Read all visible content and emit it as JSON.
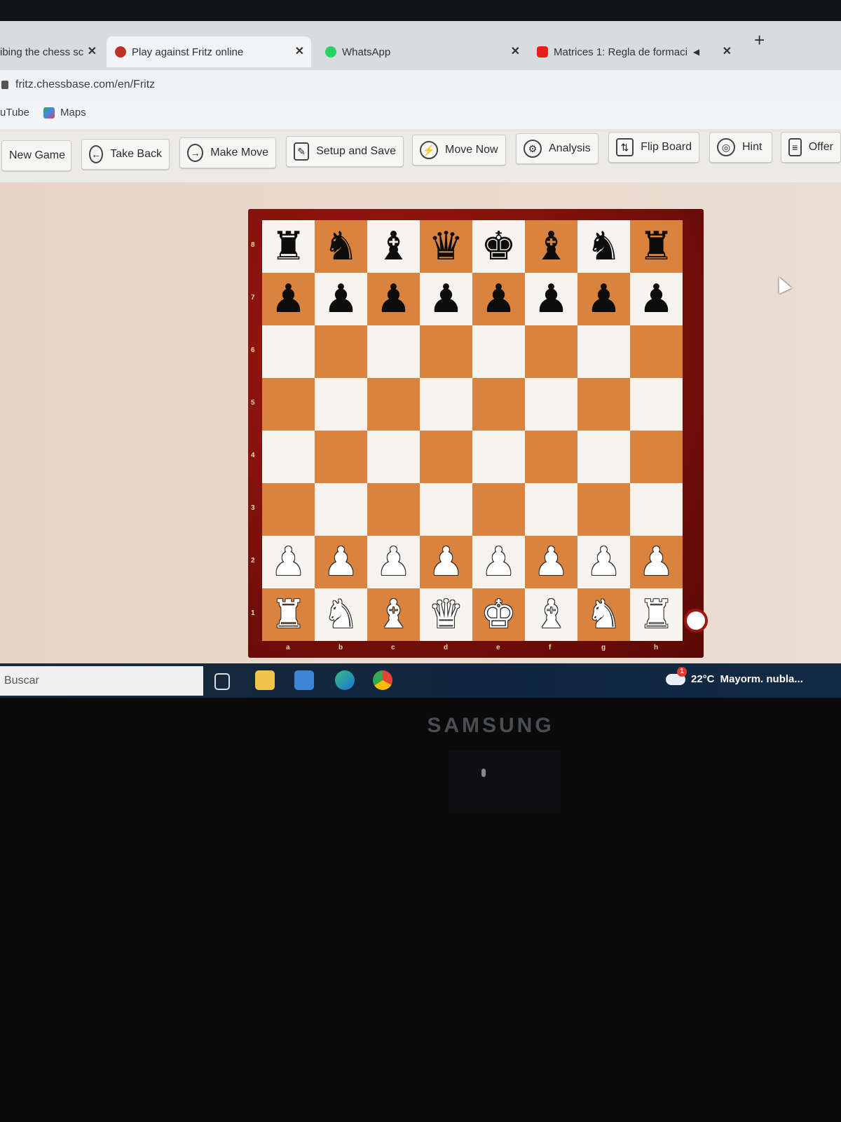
{
  "browser": {
    "tabs": [
      {
        "title": "ibing the chess sc",
        "close": "✕"
      },
      {
        "title": "Play against Fritz online",
        "close": "✕"
      },
      {
        "title": "WhatsApp",
        "close": "✕"
      },
      {
        "title": "Matrices 1: Regla de formaci",
        "close": "✕",
        "audio": "◀︎"
      }
    ],
    "new_tab": "+",
    "address": "fritz.chessbase.com/en/Fritz",
    "bookmarks": [
      {
        "label": "uTube"
      },
      {
        "label": "Maps"
      }
    ]
  },
  "toolbar": {
    "buttons": [
      {
        "label": "New Game"
      },
      {
        "label": "Take Back",
        "icon": "←"
      },
      {
        "label": "Make Move",
        "icon": "→"
      },
      {
        "label": "Setup and Save",
        "icon": "✎"
      },
      {
        "label": "Move Now",
        "icon": "⚡"
      },
      {
        "label": "Analysis",
        "icon": "⚙"
      },
      {
        "label": "Flip Board",
        "icon": "⇅"
      },
      {
        "label": "Hint",
        "icon": "◎"
      },
      {
        "label": "Offer",
        "icon": "≡"
      }
    ]
  },
  "board": {
    "ranks": [
      "8",
      "7",
      "6",
      "5",
      "4",
      "3",
      "2",
      "1"
    ],
    "files": [
      "a",
      "b",
      "c",
      "d",
      "e",
      "f",
      "g",
      "h"
    ],
    "position": [
      [
        "♜",
        "♞",
        "♝",
        "♛",
        "♚",
        "♝",
        "♞",
        "♜"
      ],
      [
        "♟",
        "♟",
        "♟",
        "♟",
        "♟",
        "♟",
        "♟",
        "♟"
      ],
      [
        "",
        "",
        "",
        "",
        "",
        "",
        "",
        ""
      ],
      [
        "",
        "",
        "",
        "",
        "",
        "",
        "",
        ""
      ],
      [
        "",
        "",
        "",
        "",
        "",
        "",
        "",
        ""
      ],
      [
        "",
        "",
        "",
        "",
        "",
        "",
        "",
        ""
      ],
      [
        "♟",
        "♟",
        "♟",
        "♟",
        "♟",
        "♟",
        "♟",
        "♟"
      ],
      [
        "♜",
        "♞",
        "♝",
        "♛",
        "♚",
        "♝",
        "♞",
        "♜"
      ]
    ],
    "colors": {
      "light": "#f7f3ee",
      "dark": "#d9833e",
      "frame": "#8f140d"
    }
  },
  "taskbar": {
    "search_placeholder": "Buscar",
    "weather": {
      "temp": "22°C",
      "desc": "Mayorm. nubla...",
      "badge": "1"
    }
  },
  "monitor": {
    "brand": "SAMSUNG"
  }
}
